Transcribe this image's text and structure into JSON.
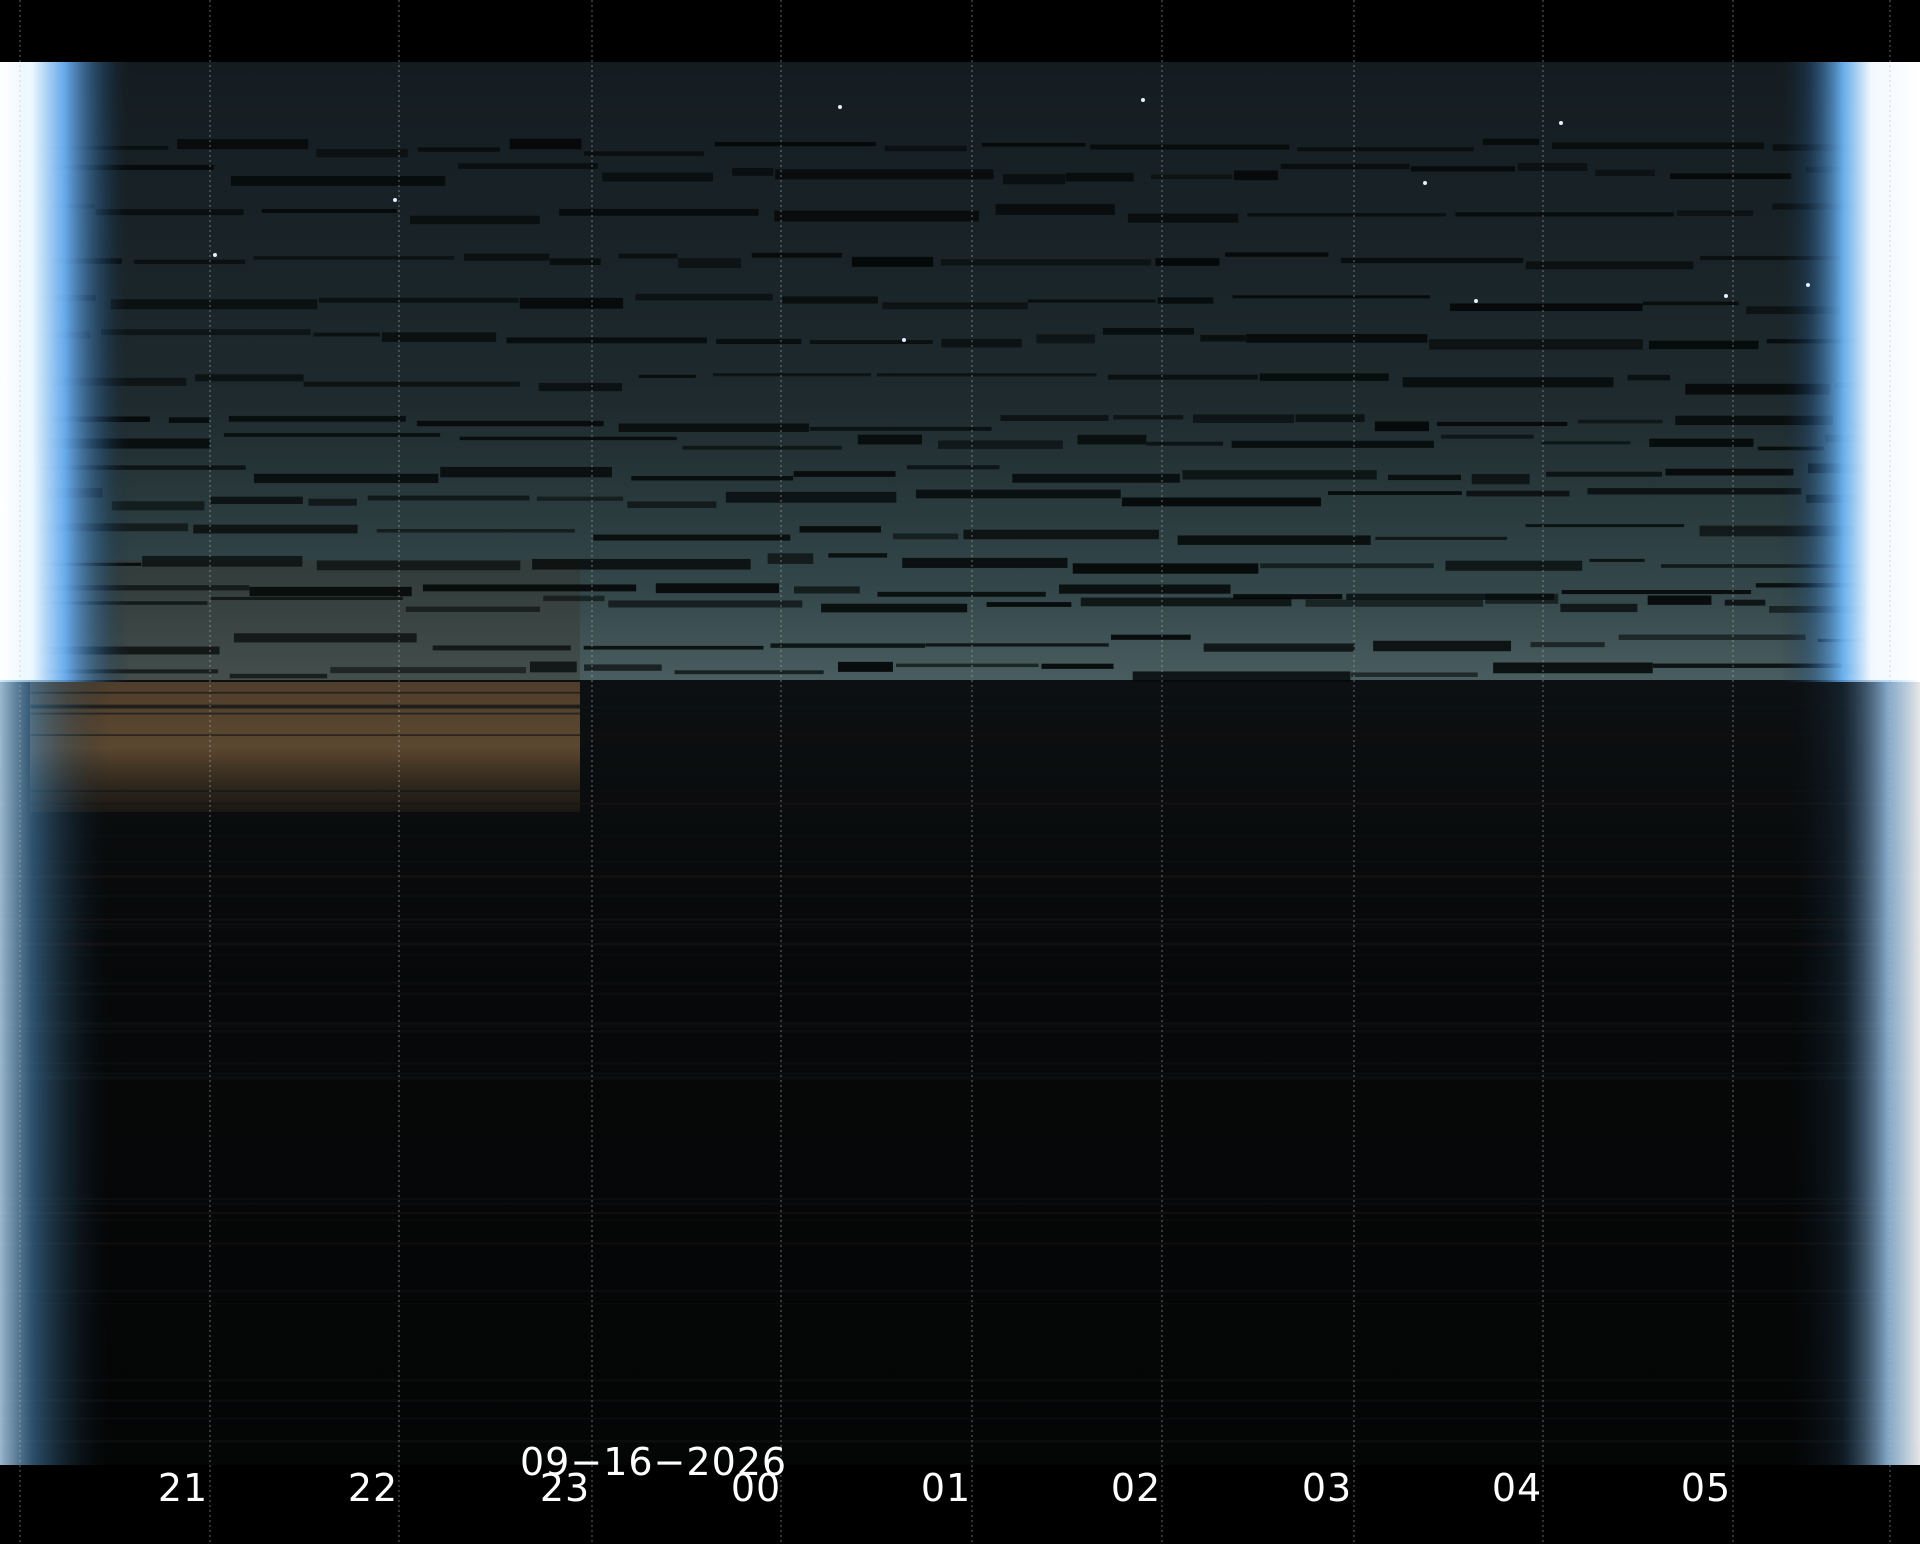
{
  "date": "09−16−2026",
  "time_ticks": [
    "21",
    "22",
    "23",
    "00",
    "01",
    "02",
    "03",
    "04",
    "05"
  ],
  "colors": {
    "background": "#000000",
    "sky": "#1c2a2e",
    "twilight": "#8fd0ff",
    "ground": "#050607",
    "gridline": "#bbbbbb",
    "label": "#ffffff"
  }
}
